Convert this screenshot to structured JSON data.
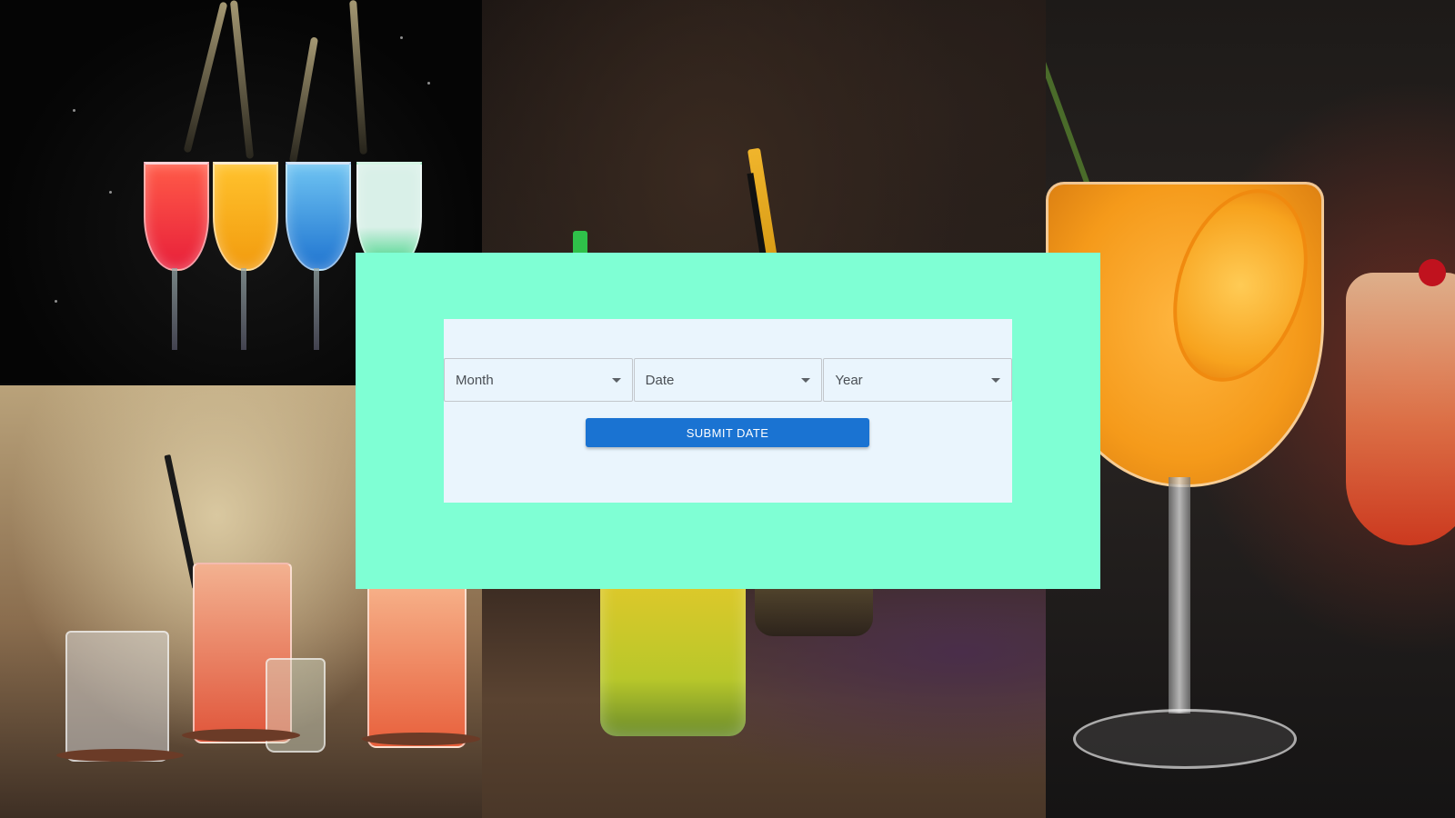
{
  "form": {
    "selects": [
      {
        "name": "month",
        "label": "Month"
      },
      {
        "name": "date",
        "label": "Date"
      },
      {
        "name": "year",
        "label": "Year"
      }
    ],
    "submit_label": "SUBMIT DATE"
  },
  "colors": {
    "panel_background": "#7fffd4",
    "card_background": "#eaf5fd",
    "button_primary": "#1a73d2",
    "button_text": "#ffffff"
  },
  "icons": {
    "select_caret": "chevron-down-icon"
  }
}
